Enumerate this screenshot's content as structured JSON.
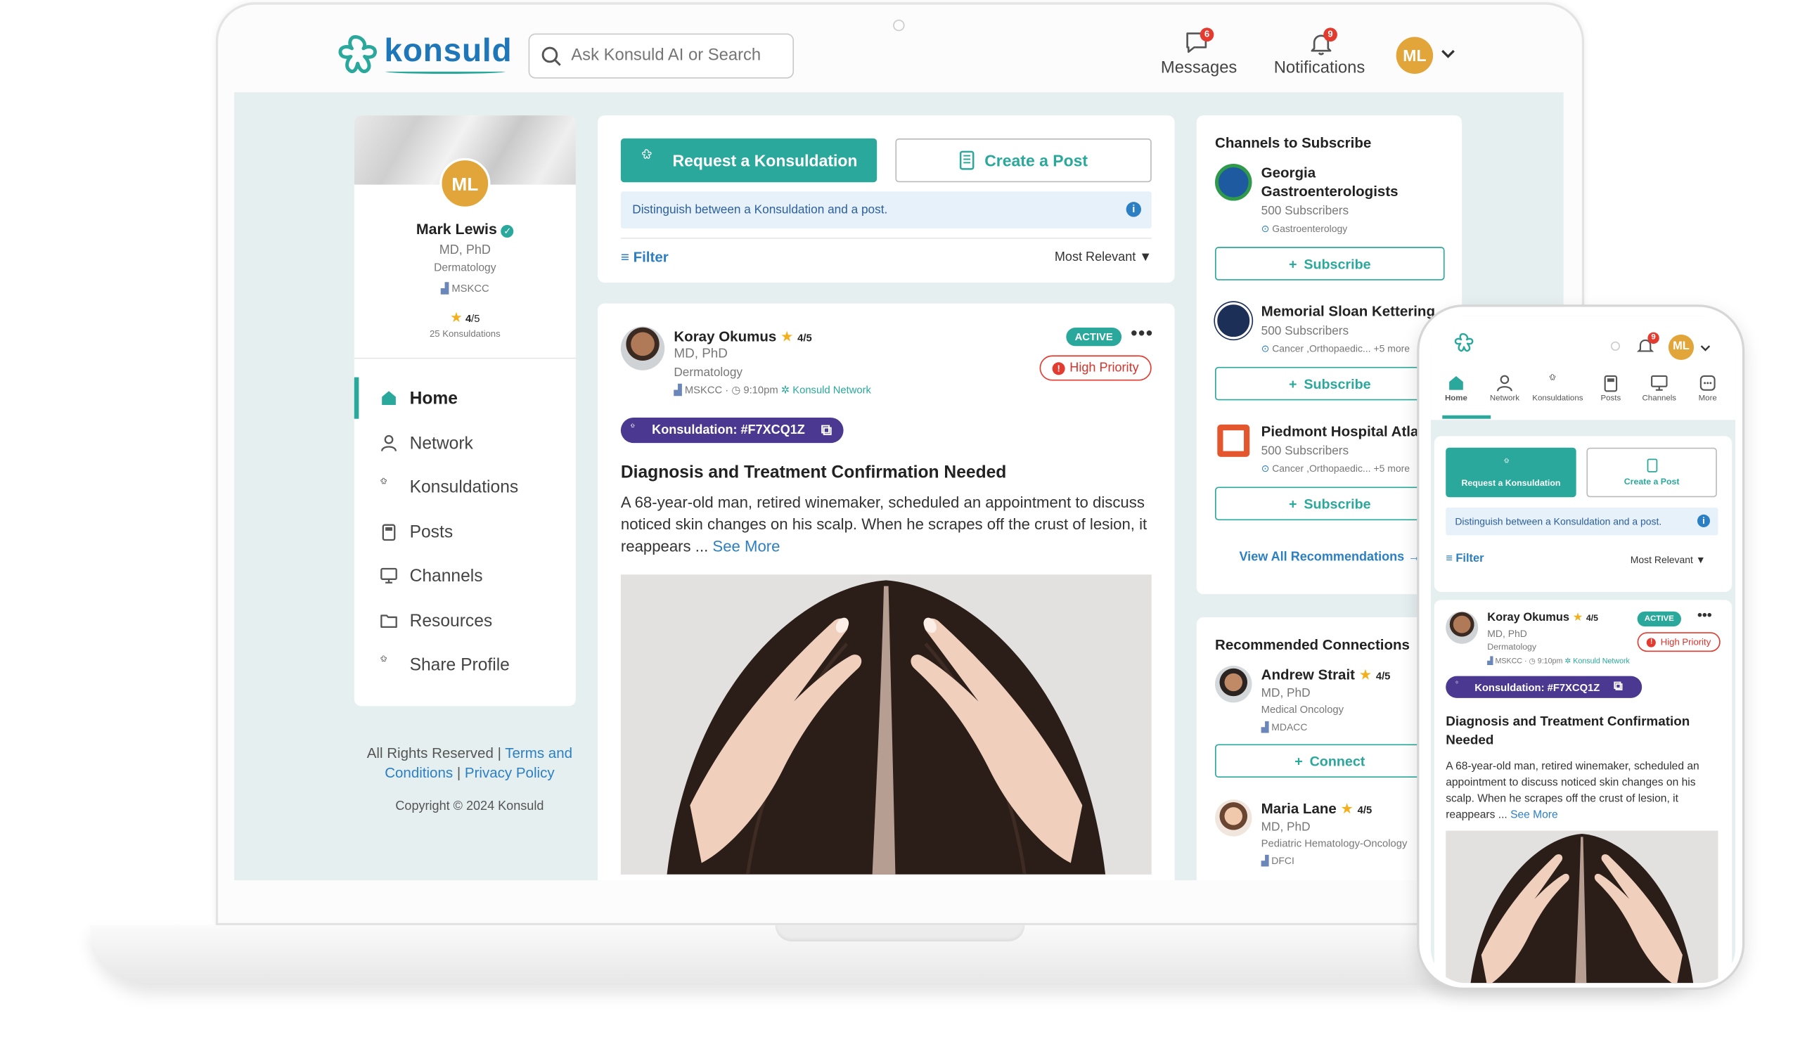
{
  "brand": {
    "name": "konsuld",
    "accent": "#2aa89b",
    "link": "#2b7fc2",
    "avatar_bg": "#e2a53a",
    "purple": "#4b3891",
    "danger": "#e33b2f"
  },
  "header": {
    "search_placeholder": "Ask Konsuld AI or Search",
    "messages": {
      "label": "Messages",
      "count": "6",
      "icon": "message-icon"
    },
    "notifications": {
      "label": "Notifications",
      "count": "9",
      "icon": "bell-icon"
    },
    "avatar_initials": "ML"
  },
  "profile": {
    "initials": "ML",
    "name": "Mark Lewis",
    "degree": "MD, PhD",
    "specialty": "Dermatology",
    "org": "MSKCC",
    "rating": "4",
    "rating_max": "/5",
    "konsuldations": "25 Konsuldations"
  },
  "sidebar": {
    "items": [
      {
        "label": "Home",
        "icon": "home-icon"
      },
      {
        "label": "Network",
        "icon": "user-icon"
      },
      {
        "label": "Konsuldations",
        "icon": "konsuld-icon"
      },
      {
        "label": "Posts",
        "icon": "clipboard-icon"
      },
      {
        "label": "Channels",
        "icon": "monitor-icon"
      },
      {
        "label": "Resources",
        "icon": "folder-icon"
      },
      {
        "label": "Share Profile",
        "icon": "share-icon"
      }
    ]
  },
  "footer": {
    "rights": "All Rights Reserved |",
    "terms": "Terms and Conditions",
    "sep": "|",
    "privacy": "Privacy Policy",
    "copyright": "Copyright © 2024 Konsuld"
  },
  "composer": {
    "request_label": "Request a Konsuldation",
    "post_label": "Create a Post",
    "info": "Distinguish between a Konsuldation and a post.",
    "filter": "Filter",
    "sort": "Most Relevant"
  },
  "post": {
    "author": "Koray Okumus",
    "rating": "4",
    "rating_max": "/5",
    "degree": "MD, PhD",
    "specialty": "Dermatology",
    "org": "MSKCC",
    "time": "9:10pm",
    "network": "Konsuld Network",
    "status": "ACTIVE",
    "priority": "High Priority",
    "konsuldation_id": "Konsuldation: #F7XCQ1Z",
    "title": "Diagnosis and Treatment Confirmation Needed",
    "body": "A 68-year-old man, retired winemaker, scheduled an appointment to discuss noticed skin changes on his scalp. When he scrapes off the crust of lesion, it reappears ...",
    "see_more": "See More"
  },
  "channels": {
    "title": "Channels to Subscribe",
    "subscribe_label": "Subscribe",
    "view_all": "View All Recommendations",
    "items": [
      {
        "name": "Georgia Gastroenterologists",
        "subs": "500 Subscribers",
        "tags": "Gastroenterology",
        "more": ""
      },
      {
        "name": "Memorial Sloan Kettering",
        "subs": "500 Subscribers",
        "tags": "Cancer ,Orthopaedic...",
        "more": "+5 more"
      },
      {
        "name": "Piedmont Hospital Atla",
        "subs": "500 Subscribers",
        "tags": "Cancer ,Orthopaedic...",
        "more": "+5 more"
      }
    ]
  },
  "connections": {
    "title": "Recommended Connections",
    "connect_label": "Connect",
    "items": [
      {
        "name": "Andrew Strait",
        "rating": "4",
        "rating_max": "/5",
        "degree": "MD, PhD",
        "specialty": "Medical Oncology",
        "org": "MDACC"
      },
      {
        "name": "Maria Lane",
        "rating": "4",
        "rating_max": "/5",
        "degree": "MD, PhD",
        "specialty": "Pediatric Hematology-Oncology",
        "org": "DFCI"
      }
    ]
  },
  "mobile": {
    "initials": "ML",
    "notif_count": "9",
    "tabs": [
      {
        "label": "Home"
      },
      {
        "label": "Network"
      },
      {
        "label": "Konsuldations"
      },
      {
        "label": "Posts"
      },
      {
        "label": "Channels"
      },
      {
        "label": "More"
      }
    ],
    "request_label": "Request a Konsuldation",
    "post_label": "Create a Post",
    "info": "Distinguish between a Konsuldation and a post.",
    "filter": "Filter",
    "sort": "Most Relevant",
    "title": "Diagnosis and Treatment Confirmation Needed",
    "body": "A 68-year-old man, retired winemaker, scheduled an appointment to discuss noticed skin changes on his scalp. When he scrapes off the crust of lesion, it reappears ...",
    "see_more": "See More"
  }
}
